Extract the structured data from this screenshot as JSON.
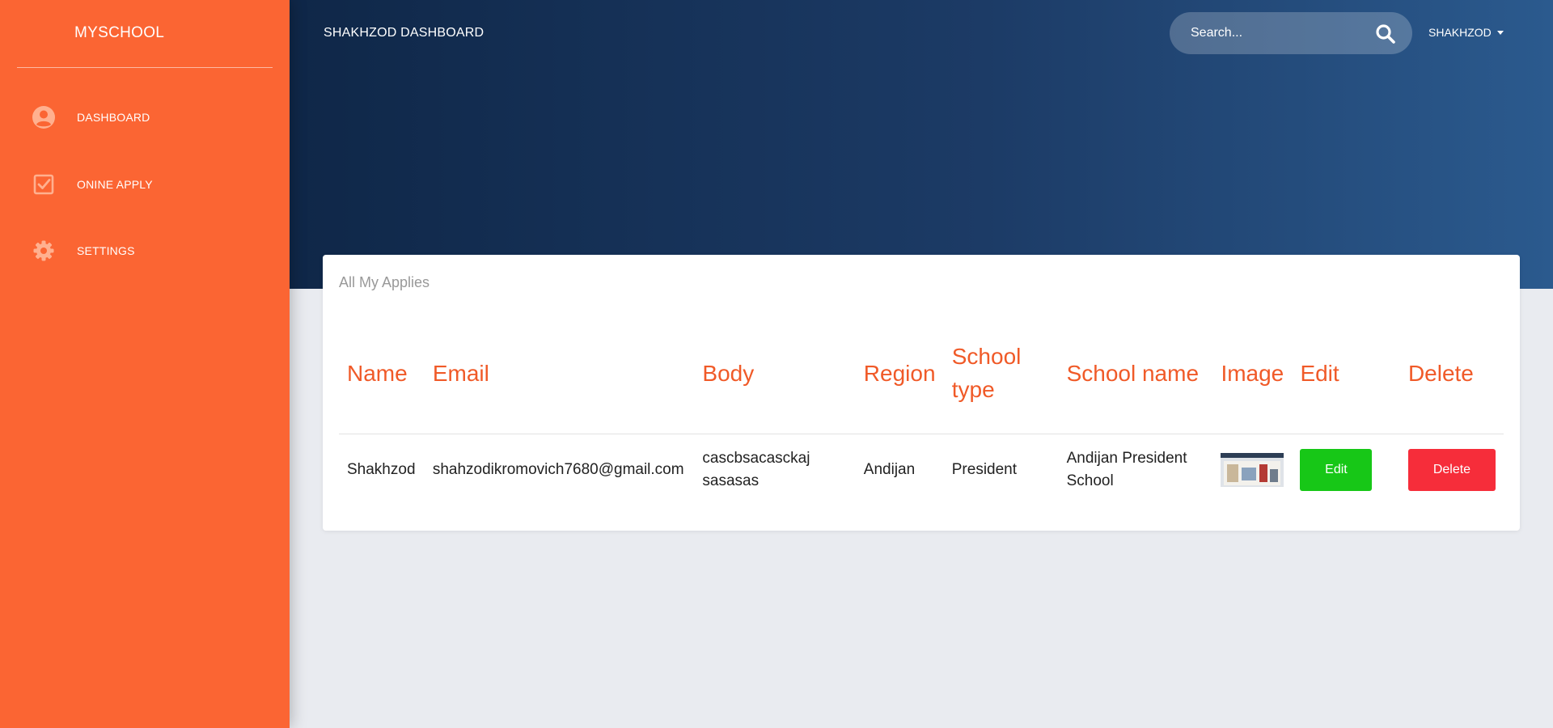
{
  "sidebar": {
    "brand": "MYSCHOOL",
    "items": [
      {
        "label": "DASHBOARD",
        "icon": "user-circle-icon"
      },
      {
        "label": "ONINE APPLY",
        "icon": "checkbox-icon"
      },
      {
        "label": "SETTINGS",
        "icon": "gear-icon"
      }
    ]
  },
  "header": {
    "title": "SHAKHZOD DASHBOARD",
    "search_placeholder": "Search...",
    "user": "SHAKHZOD"
  },
  "card": {
    "title": "All My Applies",
    "columns": [
      "Name",
      "Email",
      "Body",
      "Region",
      "School type",
      "School name",
      "Image",
      "Edit",
      "Delete"
    ],
    "rows": [
      {
        "name": "Shakhzod",
        "email": "shahzodikromovich7680@gmail.com",
        "body": "cascbsacasckaj sasasas",
        "region": "Andijan",
        "school_type": "President",
        "school_name": "Andijan President School",
        "edit_label": "Edit",
        "delete_label": "Delete"
      }
    ]
  },
  "colors": {
    "sidebar": "#fb6533",
    "accent": "#f05a28",
    "edit": "#17c717",
    "delete": "#f62d3a",
    "header_dark": "#0f2748",
    "header_light": "#2b5a8e"
  }
}
